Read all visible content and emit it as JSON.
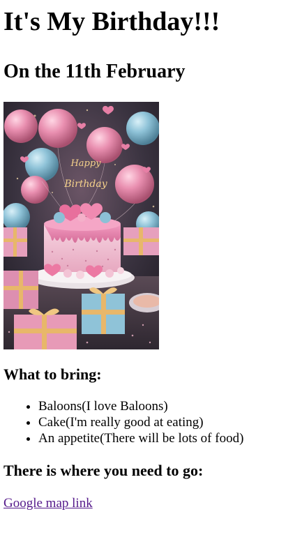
{
  "heading": "It's My Birthday!!!",
  "subheading": "On the 11th February",
  "hero_image": {
    "sign_line1": "Happy",
    "sign_line2": "Birthday"
  },
  "bring_heading": "What to bring:",
  "bring_items": [
    "Baloons(I love Baloons)",
    "Cake(I'm really good at eating)",
    "An appetite(There will be lots of food)"
  ],
  "location_heading": "There is where you need to go:",
  "map_link_text": "Google map link",
  "colors": {
    "visited_link": "#551a8b",
    "pink_balloon": "#e58fae",
    "blue_balloon": "#8fc3d8",
    "background_dark": "#2b2a33"
  }
}
